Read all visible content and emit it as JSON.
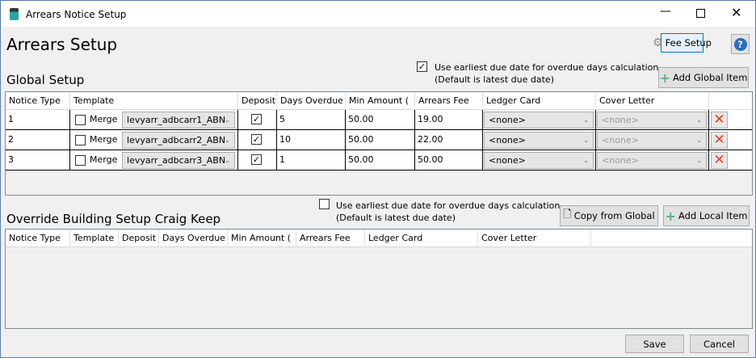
{
  "window": {
    "title": "Arrears Notice Setup"
  },
  "header": {
    "title": "Arrears Setup",
    "fee_setup": "Fee Setup",
    "help": "?"
  },
  "global": {
    "title": "Global Setup",
    "earliest_checked": true,
    "earliest_line1": "Use earliest due date for overdue days calculation",
    "earliest_line2": "(Default is latest due date)",
    "add_label": "Add Global Item",
    "columns": [
      "Notice Type",
      "Template",
      "Deposit",
      "Days Overdue",
      "Min Amount (",
      "Arrears Fee",
      "Ledger Card",
      "Cover Letter"
    ],
    "merge_label": "Merge",
    "rows": [
      {
        "notice_type": "1",
        "merge": false,
        "template": "levyarr_adbcarr1_ABN",
        "deposit": true,
        "days_overdue": "5",
        "min_amount": "50.00",
        "arrears_fee": "19.00",
        "ledger_card": "<none>",
        "cover_letter": "<none>"
      },
      {
        "notice_type": "2",
        "merge": false,
        "template": "levyarr_adbcarr2_ABN",
        "deposit": true,
        "days_overdue": "10",
        "min_amount": "50.00",
        "arrears_fee": "22.00",
        "ledger_card": "<none>",
        "cover_letter": "<none>"
      },
      {
        "notice_type": "3",
        "merge": false,
        "template": "levyarr_adbcarr3_ABN",
        "deposit": true,
        "days_overdue": "1",
        "min_amount": "50.00",
        "arrears_fee": "50.00",
        "ledger_card": "<none>",
        "cover_letter": "<none>"
      }
    ]
  },
  "override": {
    "title": "Override Building Setup Craig Keep",
    "earliest_checked": false,
    "earliest_line1": "Use earliest due date for overdue days calculation",
    "earliest_line2": "(Default is latest due date)",
    "copy_label": "Copy from Global",
    "add_label": "Add Local Item",
    "columns": [
      "Notice Type",
      "Template",
      "Deposit",
      "Days Overdue",
      "Min Amount (",
      "Arrears Fee",
      "Ledger Card",
      "Cover Letter"
    ]
  },
  "footer": {
    "save": "Save",
    "cancel": "Cancel"
  },
  "colors": {
    "accent": "#0078d7",
    "delete": "#e0462a",
    "plus": "#5fae7e"
  }
}
